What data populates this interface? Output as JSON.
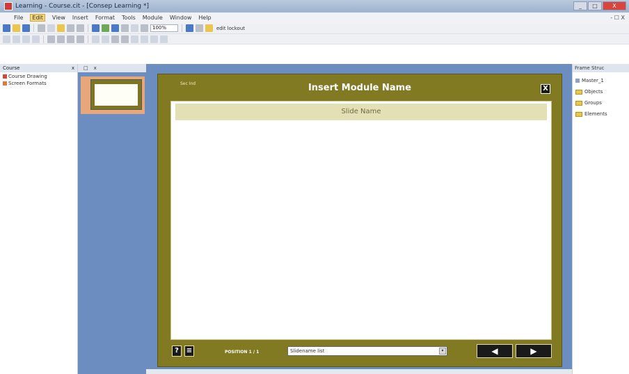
{
  "titlebar": {
    "title": "Learning - Course.cit - [Consep Learning *]",
    "buttons": [
      "_",
      "□",
      "X"
    ]
  },
  "menubar": {
    "items": [
      "File",
      "Edit",
      "View",
      "Insert",
      "Format",
      "Tools",
      "Module",
      "Window",
      "Help"
    ],
    "active_index": 1,
    "doc_controls": "- ☐ X"
  },
  "toolbar": {
    "zoom": "100%",
    "label": "edit lockout"
  },
  "left_pane": {
    "header": "Course",
    "close": "x",
    "items": [
      "Course Drawing",
      "Screen Formats"
    ]
  },
  "thumbs_pane": {
    "tabs": [
      "□",
      "x"
    ]
  },
  "slide": {
    "module_tag": "Sec Ind",
    "title": "Insert Module Name",
    "close_label": "X",
    "slide_name": "Slide Name",
    "help_icon": "?",
    "doc_icon": "≡",
    "position_label": "POSITION 1 / 1",
    "nav_select_value": "Slidename list",
    "nav_select_caret": "▾",
    "prev_label": "◀",
    "next_label": "▶"
  },
  "right_pane": {
    "header": "Frame Struc",
    "items": [
      "Master_1",
      "Objects",
      "Groups",
      "Elements"
    ]
  },
  "colors": {
    "frame_olive": "#817a22",
    "workspace_blue": "#6c8dc0",
    "slide_name_bar": "#e4e0b6"
  }
}
